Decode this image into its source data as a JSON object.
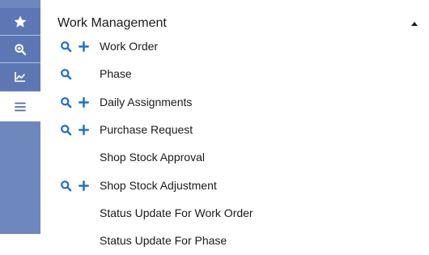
{
  "sidebar": {
    "buttons": [
      {
        "name": "favorites-star-icon",
        "active": false
      },
      {
        "name": "search-zoom-icon",
        "active": false
      },
      {
        "name": "chart-icon",
        "active": false
      },
      {
        "name": "menu-icon",
        "active": true
      }
    ]
  },
  "panel": {
    "title": "Work Management",
    "collapse_icon": "caret-up-icon"
  },
  "menu": {
    "items": [
      {
        "label": "Work Order",
        "search": true,
        "add": true
      },
      {
        "label": "Phase",
        "search": true,
        "add": false
      },
      {
        "label": "Daily Assignments",
        "search": true,
        "add": true
      },
      {
        "label": "Purchase Request",
        "search": true,
        "add": true
      },
      {
        "label": "Shop Stock Approval",
        "search": false,
        "add": false
      },
      {
        "label": "Shop Stock Adjustment",
        "search": true,
        "add": true
      },
      {
        "label": "Status Update For Work Order",
        "search": false,
        "add": false
      },
      {
        "label": "Status Update For Phase",
        "search": false,
        "add": false
      }
    ]
  },
  "colors": {
    "rail": "#6e87bd",
    "rail_button": "#5d77b4",
    "accent_icon": "#1f6fd1"
  }
}
